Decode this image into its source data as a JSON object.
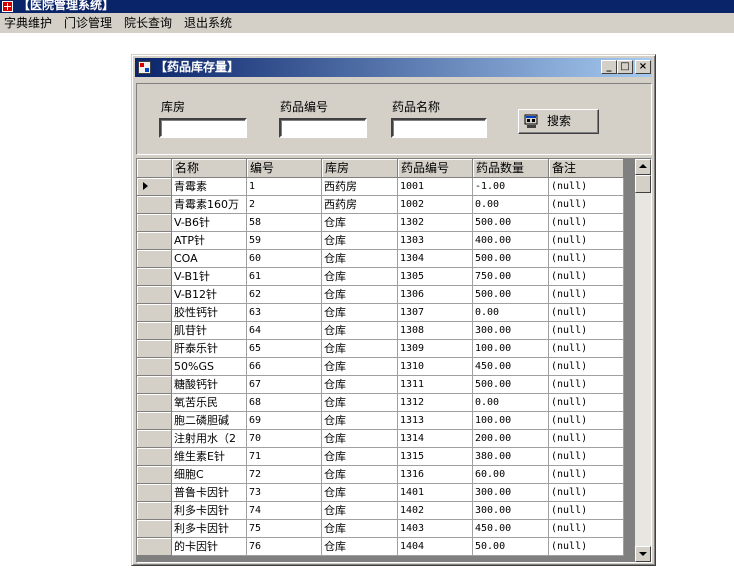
{
  "app": {
    "title": "【医院管理系统】"
  },
  "menu": [
    "字典维护",
    "门诊管理",
    "院长查询",
    "退出系统"
  ],
  "window": {
    "title": "【药品库存量】",
    "buttons": {
      "minimize": "_",
      "maximize": "□",
      "close": "×"
    }
  },
  "search": {
    "warehouse_label": "库房",
    "drug_code_label": "药品编号",
    "drug_name_label": "药品名称",
    "warehouse_value": "",
    "drug_code_value": "",
    "drug_name_value": "",
    "button_label": "搜索"
  },
  "grid": {
    "columns": [
      "名称",
      "编号",
      "库房",
      "药品编号",
      "药品数量",
      "备注"
    ],
    "rows": [
      [
        "青霉素",
        "1",
        "西药房",
        "1001",
        "-1.00",
        "(null)"
      ],
      [
        "青霉素160万",
        "2",
        "西药房",
        "1002",
        "0.00",
        "(null)"
      ],
      [
        "V-B6针",
        "58",
        "仓库",
        "1302",
        "500.00",
        "(null)"
      ],
      [
        "ATP针",
        "59",
        "仓库",
        "1303",
        "400.00",
        "(null)"
      ],
      [
        "COA",
        "60",
        "仓库",
        "1304",
        "500.00",
        "(null)"
      ],
      [
        "V-B1针",
        "61",
        "仓库",
        "1305",
        "750.00",
        "(null)"
      ],
      [
        "V-B12针",
        "62",
        "仓库",
        "1306",
        "500.00",
        "(null)"
      ],
      [
        "胶性钙针",
        "63",
        "仓库",
        "1307",
        "0.00",
        "(null)"
      ],
      [
        "肌苷针",
        "64",
        "仓库",
        "1308",
        "300.00",
        "(null)"
      ],
      [
        "肝泰乐针",
        "65",
        "仓库",
        "1309",
        "100.00",
        "(null)"
      ],
      [
        "50%GS",
        "66",
        "仓库",
        "1310",
        "450.00",
        "(null)"
      ],
      [
        "糖酸钙针",
        "67",
        "仓库",
        "1311",
        "500.00",
        "(null)"
      ],
      [
        "氧苦乐民",
        "68",
        "仓库",
        "1312",
        "0.00",
        "(null)"
      ],
      [
        "胞二磷胆碱",
        "69",
        "仓库",
        "1313",
        "100.00",
        "(null)"
      ],
      [
        "注射用水（2",
        "70",
        "仓库",
        "1314",
        "200.00",
        "(null)"
      ],
      [
        "维生素E针",
        "71",
        "仓库",
        "1315",
        "380.00",
        "(null)"
      ],
      [
        "细胞C",
        "72",
        "仓库",
        "1316",
        "60.00",
        "(null)"
      ],
      [
        "普鲁卡因针",
        "73",
        "仓库",
        "1401",
        "300.00",
        "(null)"
      ],
      [
        "利多卡因针",
        "74",
        "仓库",
        "1402",
        "300.00",
        "(null)"
      ],
      [
        "利多卡因针",
        "75",
        "仓库",
        "1403",
        "450.00",
        "(null)"
      ],
      [
        "的卡因针",
        "76",
        "仓库",
        "1404",
        "50.00",
        "(null)"
      ]
    ],
    "current_row": 0
  }
}
